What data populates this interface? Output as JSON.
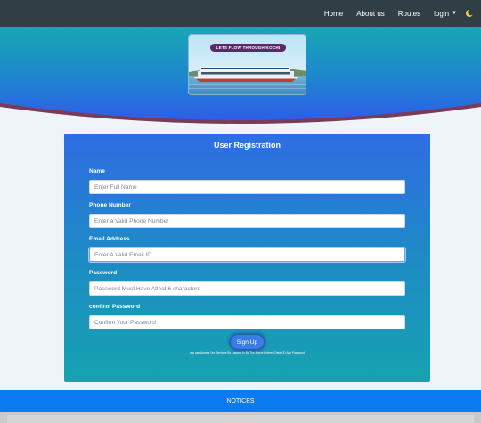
{
  "nav": {
    "items": [
      {
        "label": "Home"
      },
      {
        "label": "About us"
      },
      {
        "label": "Routes"
      }
    ],
    "login_label": "login",
    "caret_icon": "caret-down-icon",
    "theme_icon": "moon-icon"
  },
  "banner": {
    "title": "LETS FLOW THROUGH KOCHI",
    "image": "ferry-boat-image"
  },
  "form": {
    "title": "User Registration",
    "fields": [
      {
        "label": "Name",
        "placeholder": "Enter Full Name"
      },
      {
        "label": "Phone Number",
        "placeholder": "Enter a Valid Phone Number"
      },
      {
        "label": "Email Address",
        "placeholder": "Enter A Valid Email ID"
      },
      {
        "label": "Password",
        "placeholder": "Password Must Have Atleat 6 characters"
      },
      {
        "label": "confirm Password",
        "placeholder": "Confirm Your Password"
      }
    ],
    "submit_label": "Sign Up",
    "note": "you can Access Our Services By Logging In By The Above Entered Detail ID And Password"
  },
  "footer": {
    "notices_label": "NOTICES"
  },
  "colors": {
    "navbar": "#2f3f45",
    "hero_top": "#17a7b3",
    "hero_bottom": "#2d6ae6",
    "card_top": "#2f6de4",
    "card_bottom": "#16a3b0",
    "notices": "#0a7bf0"
  }
}
